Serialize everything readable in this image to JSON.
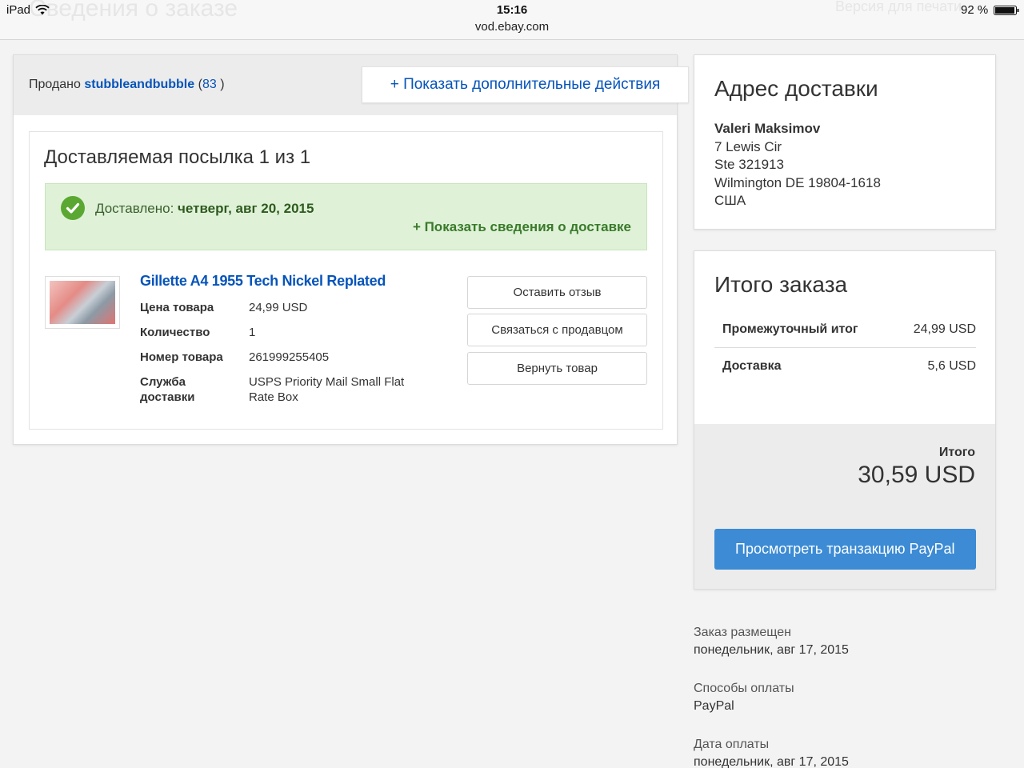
{
  "statusbar": {
    "device": "iPad",
    "time": "15:16",
    "url": "vod.ebay.com",
    "battery": "92 %",
    "ghost_title": "Сведения о заказе",
    "ghost_print": "Версия для печати"
  },
  "seller": {
    "prefix": "Продано",
    "name": "stubbleandbubble",
    "score_open": "(",
    "score": "83",
    "score_close": ")"
  },
  "more_actions_label": "+ Показать дополнительные действия",
  "package": {
    "title": "Доставляемая посылка 1 из 1",
    "delivered_label": "Доставлено:",
    "delivered_date": "четверг, авг 20, 2015",
    "details_link": "+ Показать сведения о доставке"
  },
  "item": {
    "title": "Gillette A4 1955 Tech Nickel Replated",
    "details": [
      {
        "label": "Цена товара",
        "value": "24,99 USD"
      },
      {
        "label": "Количество",
        "value": "1"
      },
      {
        "label": "Номер товара",
        "value": "261999255405"
      },
      {
        "label": "Служба доставки",
        "value": "USPS Priority Mail Small Flat Rate Box"
      }
    ],
    "actions": [
      "Оставить отзыв",
      "Связаться с продавцом",
      "Вернуть товар"
    ]
  },
  "address": {
    "heading": "Адрес доставки",
    "name": "Valeri Maksimov",
    "line1": "7 Lewis Cir",
    "line2": "Ste 321913",
    "line3": "Wilmington DE 19804-1618",
    "country": "США"
  },
  "totals": {
    "heading": "Итого заказа",
    "subtotal_label": "Промежуточный итог",
    "subtotal_value": "24,99 USD",
    "shipping_label": "Доставка",
    "shipping_value": "5,6 USD",
    "total_label": "Итого",
    "total_value": "30,59 USD",
    "paypal_button": "Просмотреть транзакцию PayPal"
  },
  "meta": [
    {
      "label": "Заказ размещен",
      "value": "понедельник, авг 17, 2015"
    },
    {
      "label": "Способы оплаты",
      "value": "PayPal"
    },
    {
      "label": "Дата оплаты",
      "value": "понедельник, авг 17, 2015"
    }
  ],
  "colors": {
    "link": "#0654ba",
    "delivered_bg": "#dff2d8",
    "check_green": "#5aa832",
    "paypal_button": "#3c8bd4"
  }
}
